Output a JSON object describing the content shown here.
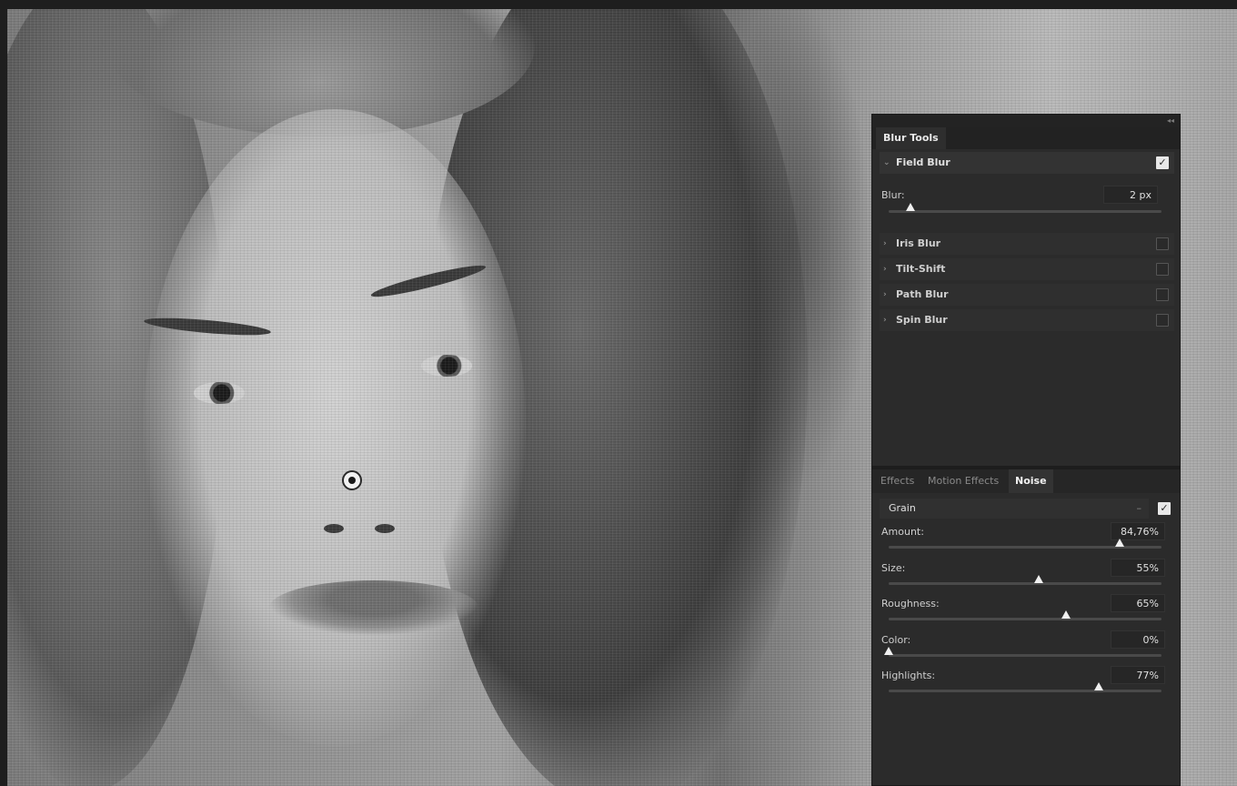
{
  "panel": {
    "title": "Blur Tools",
    "field_blur": {
      "label": "Field Blur",
      "enabled": true,
      "blur_label": "Blur:",
      "blur_value": "2 px",
      "blur_fraction": 0.08
    },
    "collapsed_sections": [
      {
        "label": "Iris Blur",
        "enabled": false
      },
      {
        "label": "Tilt-Shift",
        "enabled": false
      },
      {
        "label": "Path Blur",
        "enabled": false
      },
      {
        "label": "Spin Blur",
        "enabled": false
      }
    ],
    "effect_tabs": [
      "Effects",
      "Motion Effects",
      "Noise"
    ],
    "active_effect_tab": "Noise",
    "noise": {
      "type": "Grain",
      "enabled": true,
      "params": [
        {
          "label": "Amount:",
          "value": "84,76%",
          "fraction": 0.8476
        },
        {
          "label": "Size:",
          "value": "55%",
          "fraction": 0.55
        },
        {
          "label": "Roughness:",
          "value": "65%",
          "fraction": 0.65
        },
        {
          "label": "Color:",
          "value": "0%",
          "fraction": 0.0
        },
        {
          "label": "Highlights:",
          "value": "77%",
          "fraction": 0.77
        }
      ]
    }
  },
  "icons": {
    "blur_pin": "blur-pin-icon",
    "checkbox": "checkmark-icon",
    "expand": "chevron-right-icon",
    "collapse": "chevron-down-icon",
    "dropdown": "dropdown-arrow-icon"
  }
}
